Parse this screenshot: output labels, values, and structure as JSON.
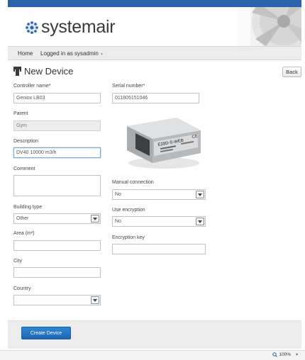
{
  "header": {
    "logo_text": "systemair",
    "accent_color": "#2a62a8"
  },
  "nav": {
    "home_label": "Home",
    "user_label": "Logged in as sysadmin"
  },
  "page": {
    "title": "New Device",
    "back_label": "Back"
  },
  "form": {
    "controller_name": {
      "label": "Controller name*",
      "value": "Geniox LB03"
    },
    "serial_number": {
      "label": "Serial number*",
      "value": "011805151046"
    },
    "parent": {
      "label": "Parent",
      "value": "Gym"
    },
    "description": {
      "label": "Description",
      "value": "DV40 10000 m3/h"
    },
    "comment": {
      "label": "Comment",
      "value": ""
    },
    "building_type": {
      "label": "Building type",
      "value": "Other"
    },
    "area": {
      "label": "Area (m²)",
      "value": ""
    },
    "city": {
      "label": "City",
      "value": ""
    },
    "country": {
      "label": "Country",
      "value": ""
    },
    "manual_connection": {
      "label": "Manual connection",
      "value": "No"
    },
    "use_encryption": {
      "label": "Use encryption",
      "value": "No"
    },
    "encryption_key": {
      "label": "Encryption key",
      "value": ""
    }
  },
  "device_image": {
    "model_text": "E28D-S-WEB",
    "icon": "controller-device-image"
  },
  "footer": {
    "create_label": "Create Device"
  },
  "statusbar": {
    "zoom_label": "100%"
  }
}
